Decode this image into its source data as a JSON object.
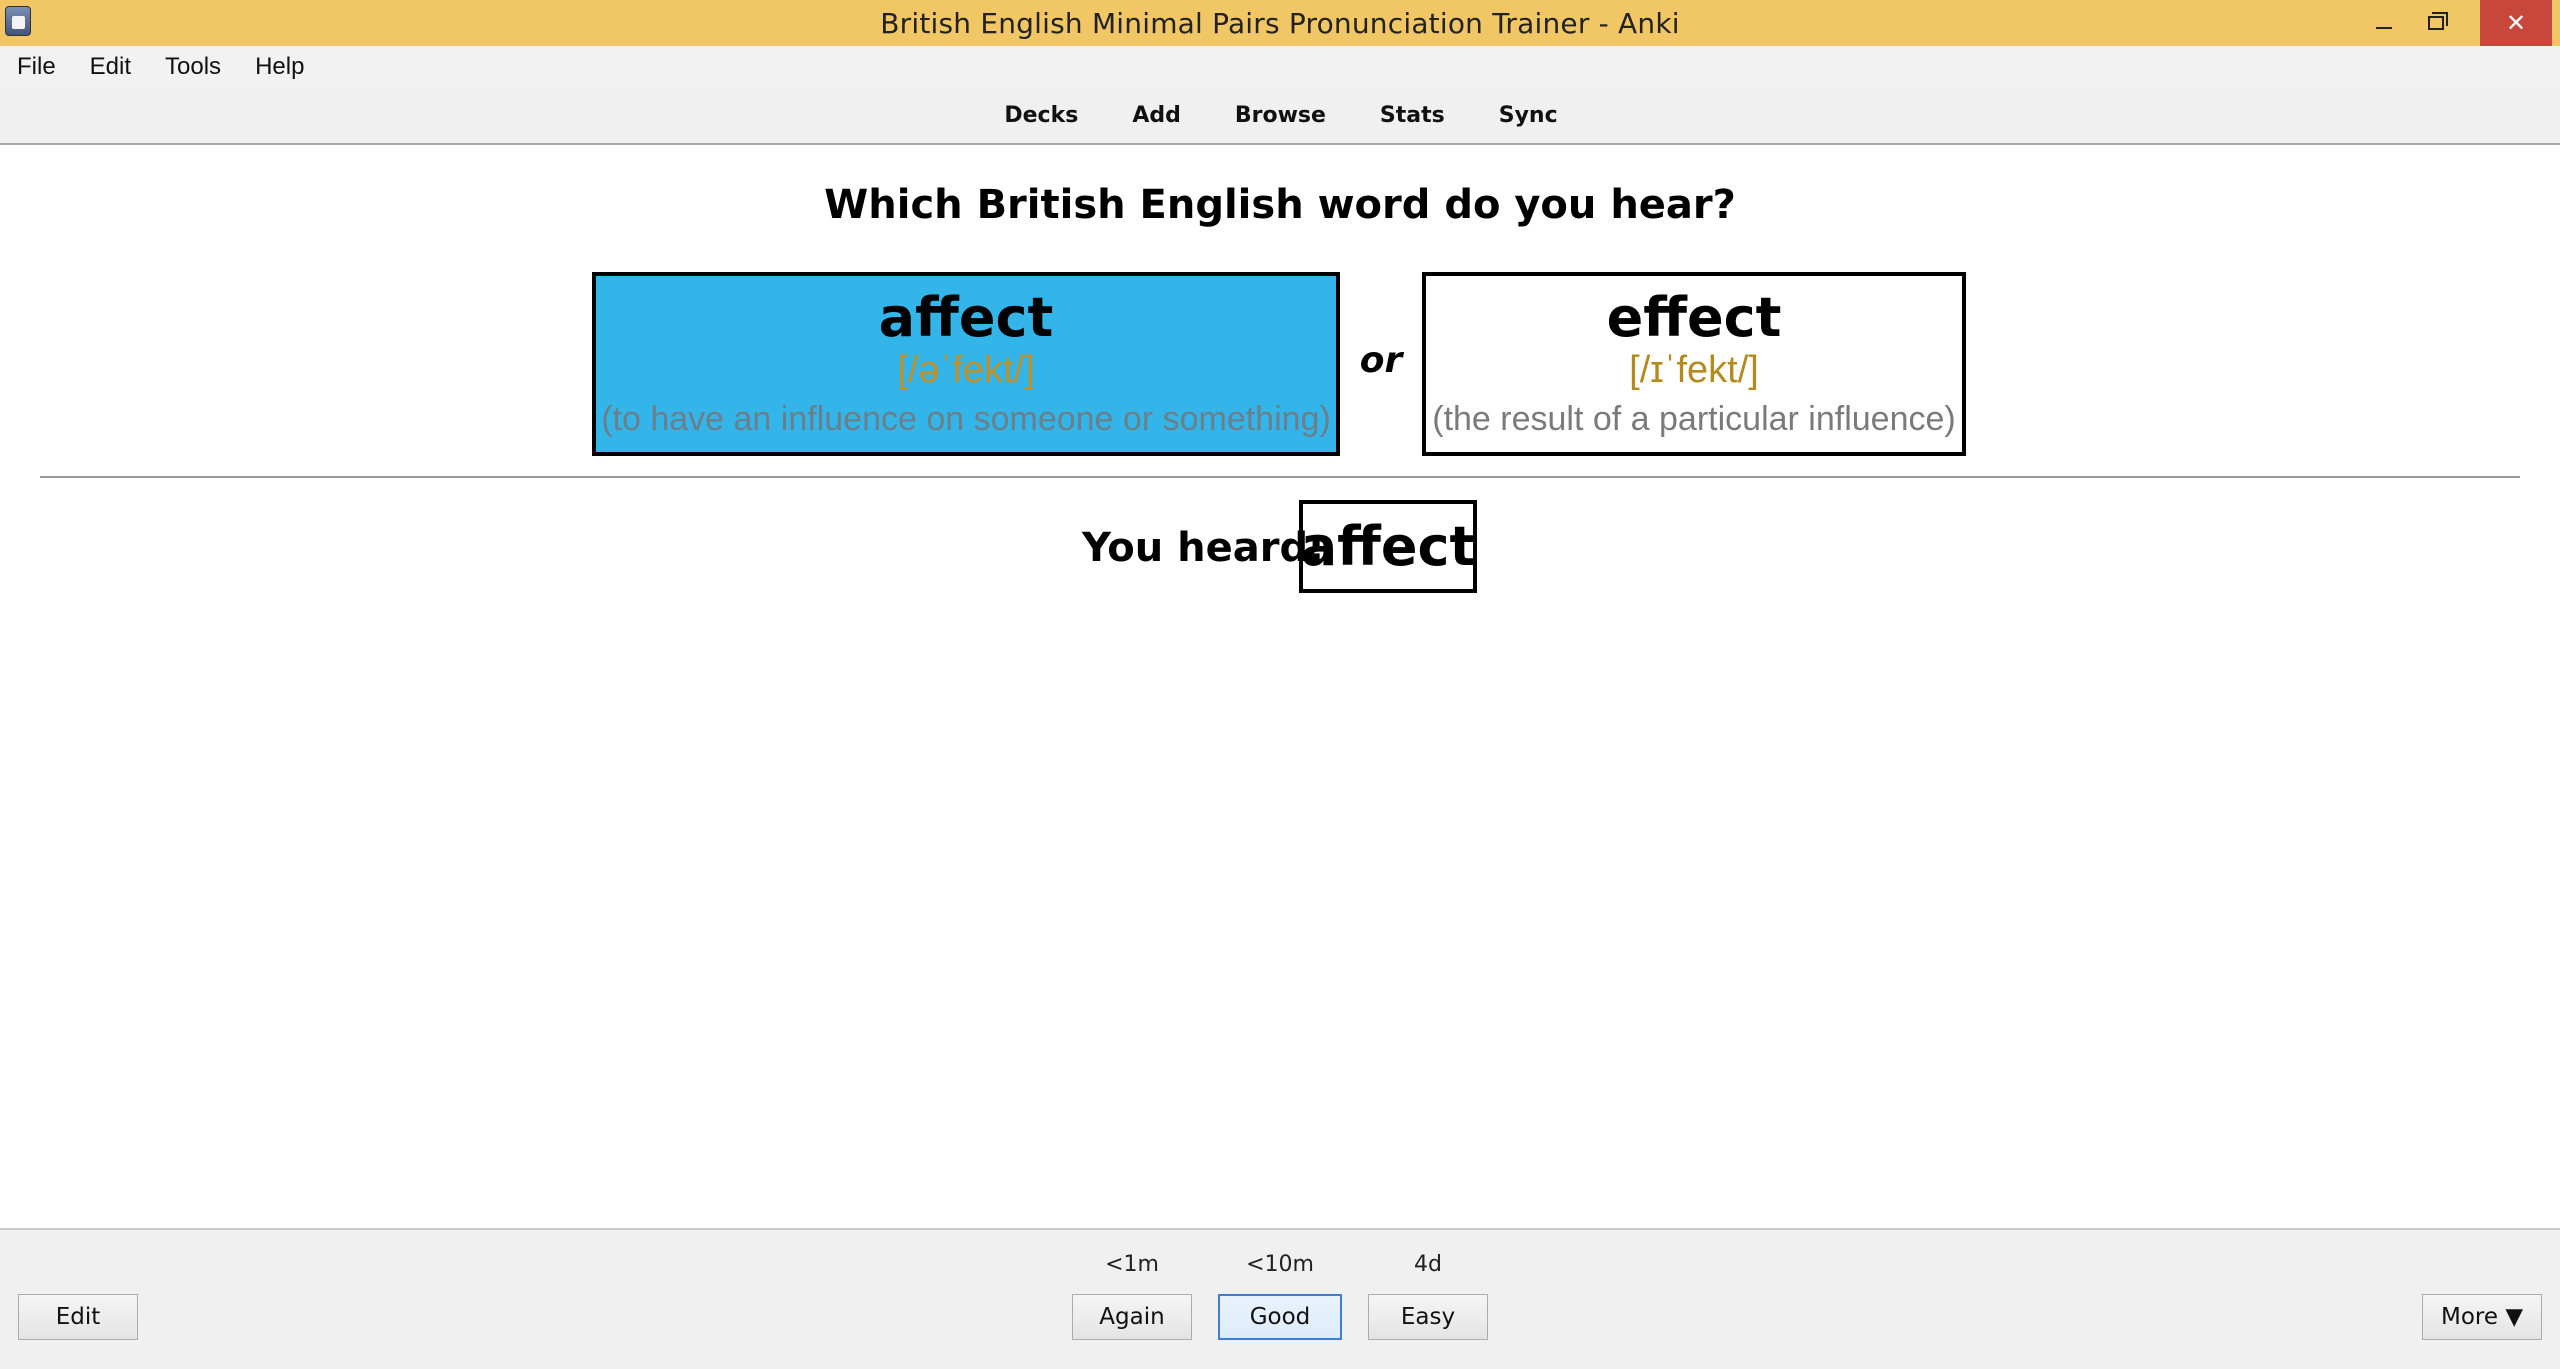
{
  "window": {
    "title": "British English Minimal Pairs Pronunciation Trainer - Anki",
    "minimize_icon": "minimize-icon",
    "maximize_icon": "restore-icon",
    "close_glyph": "✕"
  },
  "menu": {
    "items": [
      {
        "label": "File"
      },
      {
        "label": "Edit"
      },
      {
        "label": "Tools"
      },
      {
        "label": "Help"
      }
    ]
  },
  "toolbar": {
    "links": [
      {
        "label": "Decks"
      },
      {
        "label": "Add"
      },
      {
        "label": "Browse"
      },
      {
        "label": "Stats"
      },
      {
        "label": "Sync"
      }
    ]
  },
  "card": {
    "question": "Which British English word do you hear?",
    "choices": [
      {
        "word": "affect",
        "ipa": "[/əˈfekt/]",
        "gloss": "(to have an influence on someone or something)",
        "highlight_color": "#33b5ea"
      },
      {
        "word": "effect",
        "ipa": "[/ɪˈfekt/]",
        "gloss": "(the result of a particular influence)"
      }
    ],
    "or_text": "or",
    "heard_label": "You heard:",
    "heard_word": "affect"
  },
  "review": {
    "edit_label": "Edit",
    "more_label": "More ▼",
    "answers": [
      {
        "label": "Again",
        "interval": "<1m"
      },
      {
        "label": "Good",
        "interval": "<10m"
      },
      {
        "label": "Easy",
        "interval": "4d"
      }
    ]
  }
}
